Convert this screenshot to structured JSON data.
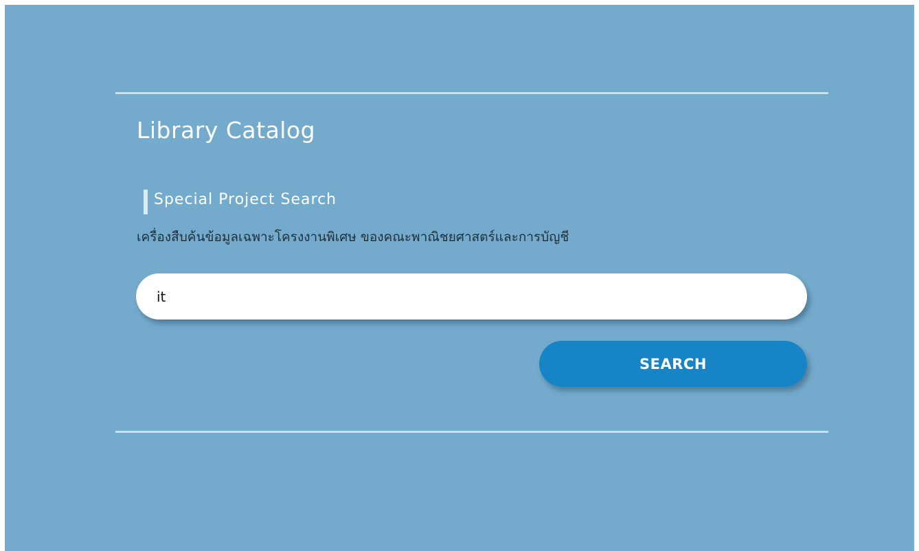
{
  "header": {
    "title": "Library Catalog"
  },
  "section": {
    "title": "Special Project Search",
    "description": "เครื่องสืบค้นข้อมูลเฉพาะโครงงานพิเศษ ของคณะพาณิชยศาสตร์และการบัญชี"
  },
  "search": {
    "value": "it",
    "button_label": "SEARCH"
  },
  "colors": {
    "background": "#74abcd",
    "button": "#1785c5",
    "rule": "#c7e1f0"
  }
}
